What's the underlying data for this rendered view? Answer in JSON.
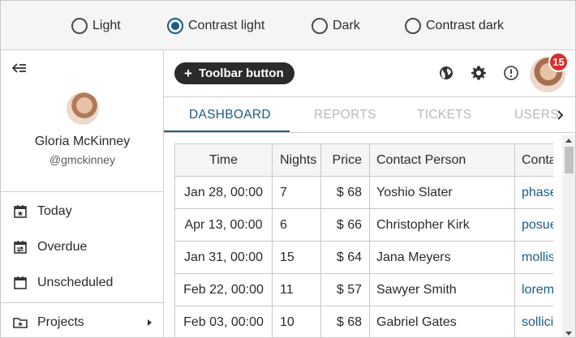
{
  "theme_options": [
    {
      "label": "Light",
      "selected": false
    },
    {
      "label": "Contrast light",
      "selected": true
    },
    {
      "label": "Dark",
      "selected": false
    },
    {
      "label": "Contrast dark",
      "selected": false
    }
  ],
  "sidebar": {
    "collapse_icon": "collapse-menu-icon",
    "user": {
      "name": "Gloria McKinney",
      "username": "@gmckinney"
    },
    "items": [
      {
        "label": "Today",
        "icon": "calendar-star-icon"
      },
      {
        "label": "Overdue",
        "icon": "calendar-arrows-icon"
      },
      {
        "label": "Unscheduled",
        "icon": "calendar-blank-icon"
      },
      {
        "label": "Projects",
        "icon": "folder-star-icon"
      }
    ]
  },
  "toolbar": {
    "button_label": "Toolbar button",
    "icons": [
      "globe-icon",
      "gear-icon",
      "alert-circle-icon"
    ],
    "badge_count": "15"
  },
  "tabs": [
    {
      "label": "DASHBOARD",
      "active": true
    },
    {
      "label": "REPORTS",
      "active": false
    },
    {
      "label": "TICKETS",
      "active": false
    },
    {
      "label": "USERS",
      "active": false
    }
  ],
  "table": {
    "columns": [
      "Time",
      "Nights",
      "Price",
      "Contact Person",
      "Contact Email"
    ],
    "rows": [
      {
        "time": "Jan 28, 00:00",
        "nights": "7",
        "price": "$ 68",
        "contact": "Yoshio Slater",
        "email": "phasellus"
      },
      {
        "time": "Apr 13, 00:00",
        "nights": "6",
        "price": "$ 66",
        "contact": "Christopher Kirk",
        "email": "posuere"
      },
      {
        "time": "Jan 31, 00:00",
        "nights": "15",
        "price": "$ 64",
        "contact": "Jana Meyers",
        "email": "mollis"
      },
      {
        "time": "Feb 22, 00:00",
        "nights": "11",
        "price": "$ 57",
        "contact": "Sawyer Smith",
        "email": "lorem"
      },
      {
        "time": "Feb 03, 00:00",
        "nights": "10",
        "price": "$ 68",
        "contact": "Gabriel Gates",
        "email": "sollicitudin"
      }
    ]
  },
  "colors": {
    "accent": "#1a5c87",
    "badge": "#d32f2f",
    "toolbar_button": "#2b2b2b"
  }
}
